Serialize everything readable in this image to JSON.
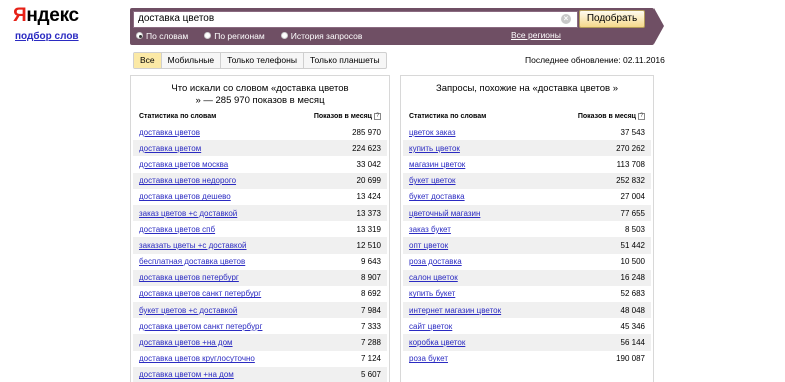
{
  "logo": {
    "first": "Я",
    "rest": "ндекс"
  },
  "sublink": "подбор слов",
  "search": {
    "value": "доставка цветов",
    "clear": "×",
    "button": "Подобрать"
  },
  "radios": [
    {
      "label": "По словам",
      "selected": true
    },
    {
      "label": "По регионам",
      "selected": false
    },
    {
      "label": "История запросов",
      "selected": false
    }
  ],
  "regions_link": "Все регионы",
  "tabs": [
    {
      "label": "Все",
      "active": true
    },
    {
      "label": "Мобильные",
      "active": false
    },
    {
      "label": "Только телефоны",
      "active": false
    },
    {
      "label": "Только планшеты",
      "active": false
    }
  ],
  "updated": "Последнее обновление: 02.11.2016",
  "left": {
    "title_line1": "Что искали со словом «доставка цветов",
    "title_line2": "» — 285 970 показов в месяц",
    "col_phrase": "Статистика по словам",
    "col_count": "Показов в месяц",
    "help": "?",
    "rows": [
      {
        "phrase": "доставка цветов",
        "count": "285 970"
      },
      {
        "phrase": "доставка цветом",
        "count": "224 623"
      },
      {
        "phrase": "доставка цветов москва",
        "count": "33 042"
      },
      {
        "phrase": "доставка цветов недорого",
        "count": "20 699"
      },
      {
        "phrase": "доставка цветов дешево",
        "count": "13 424"
      },
      {
        "phrase": "заказ цветов +с доставкой",
        "count": "13 373"
      },
      {
        "phrase": "доставка цветов спб",
        "count": "13 319"
      },
      {
        "phrase": "заказать цветы +с доставкой",
        "count": "12 510"
      },
      {
        "phrase": "бесплатная доставка цветов",
        "count": "9 643"
      },
      {
        "phrase": "доставка цветов петербург",
        "count": "8 907"
      },
      {
        "phrase": "доставка цветов санкт петербург",
        "count": "8 692"
      },
      {
        "phrase": "букет цветов +с доставкой",
        "count": "7 984"
      },
      {
        "phrase": "доставка цветом санкт петербург",
        "count": "7 333"
      },
      {
        "phrase": "доставка цветов +на дом",
        "count": "7 288"
      },
      {
        "phrase": "доставка цветов круглосуточно",
        "count": "7 124"
      },
      {
        "phrase": "доставка цветом +на дом",
        "count": "5 607"
      }
    ]
  },
  "right": {
    "title": "Запросы, похожие на «доставка цветов »",
    "col_phrase": "Статистика по словам",
    "col_count": "Показов в месяц",
    "help": "?",
    "rows": [
      {
        "phrase": "цветок заказ",
        "count": "37 543"
      },
      {
        "phrase": "купить цветок",
        "count": "270 262"
      },
      {
        "phrase": "магазин цветок",
        "count": "113 708"
      },
      {
        "phrase": "букет цветок",
        "count": "252 832"
      },
      {
        "phrase": "букет доставка",
        "count": "27 004"
      },
      {
        "phrase": "цветочный магазин",
        "count": "77 655"
      },
      {
        "phrase": "заказ букет",
        "count": "8 503"
      },
      {
        "phrase": "опт цветок",
        "count": "51 442"
      },
      {
        "phrase": "роза доставка",
        "count": "10 500"
      },
      {
        "phrase": "салон цветок",
        "count": "16 248"
      },
      {
        "phrase": "купить букет",
        "count": "52 683"
      },
      {
        "phrase": "интернет магазин цветок",
        "count": "48 048"
      },
      {
        "phrase": "сайт цветок",
        "count": "45 346"
      },
      {
        "phrase": "коробка цветок",
        "count": "56 144"
      },
      {
        "phrase": "роза букет",
        "count": "190 087"
      }
    ]
  }
}
